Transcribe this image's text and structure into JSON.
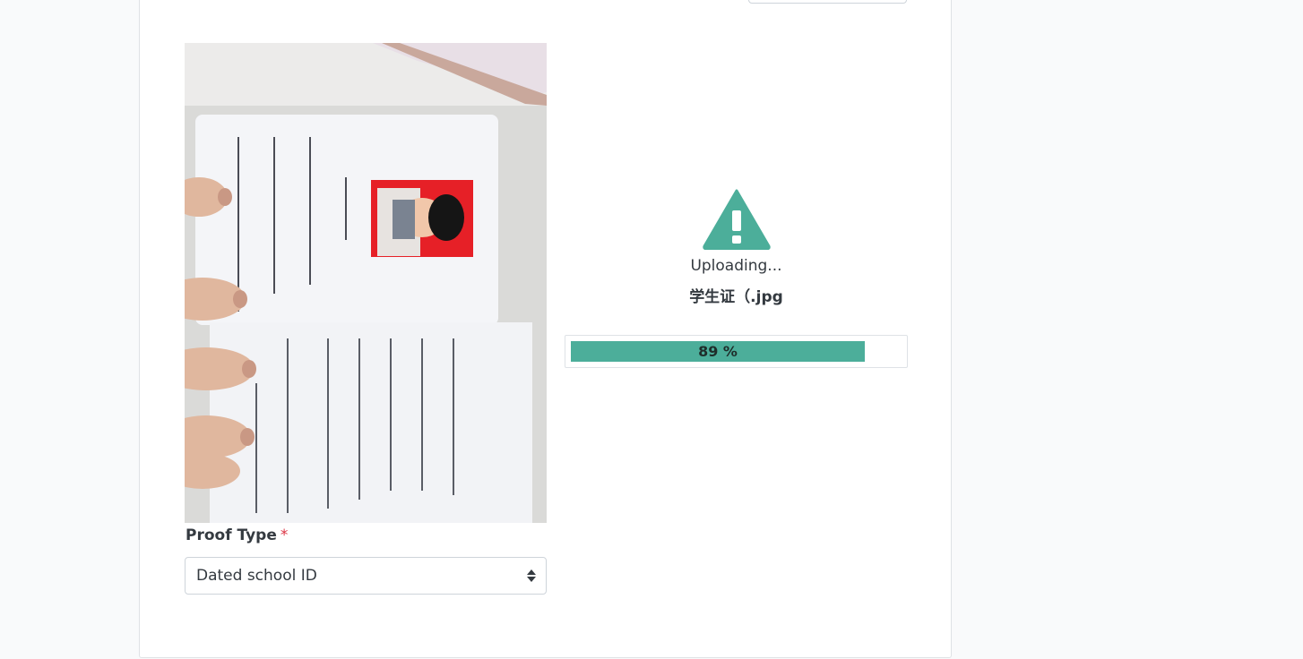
{
  "upload": {
    "status": "Uploading...",
    "file_name": "学生证（.jpg",
    "progress_percent": 89,
    "progress_label": "89 %",
    "icon": "warning-triangle-icon"
  },
  "form": {
    "proof_type_label": "Proof Type",
    "required_marker": "*",
    "proof_type_value": "Dated school ID"
  },
  "colors": {
    "accent": "#4cae9a",
    "required": "#dc3545"
  }
}
